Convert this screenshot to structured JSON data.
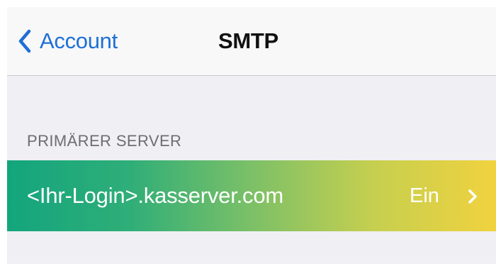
{
  "navbar": {
    "back_label": "Account",
    "title": "SMTP"
  },
  "section": {
    "header": "PRIMÄRER SERVER"
  },
  "server_row": {
    "label": "<Ihr-Login>.kasserver.com",
    "value": "Ein"
  },
  "icons": {
    "back": "chevron-left-icon",
    "disclosure": "chevron-right-icon"
  },
  "colors": {
    "accent": "#1f6fd6",
    "row_gradient_start": "#13a57d",
    "row_gradient_end": "#f1d23f",
    "background": "#efeff4"
  }
}
